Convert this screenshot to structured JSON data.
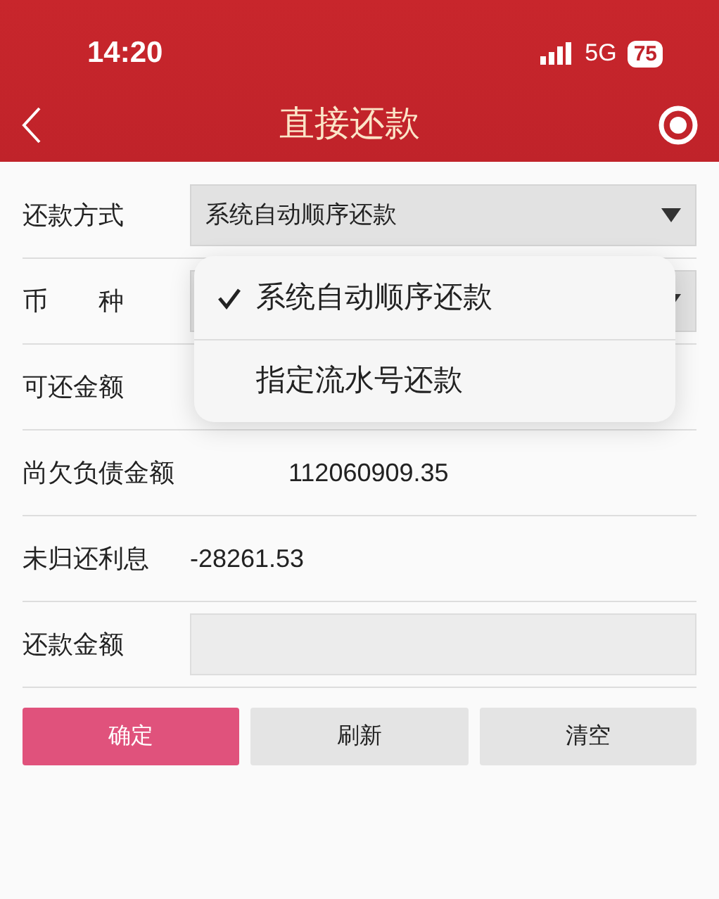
{
  "status_bar": {
    "time": "14:20",
    "network": "5G",
    "battery": "75"
  },
  "nav": {
    "title": "直接还款"
  },
  "form": {
    "rows": [
      {
        "kind": "select",
        "label": "还款方式",
        "value": "系统自动顺序还款"
      },
      {
        "kind": "select",
        "label": "币　　种"
      },
      {
        "kind": "text",
        "label": "可还金额"
      },
      {
        "kind": "text",
        "label": "尚欠负债金额",
        "value": "112060909.35"
      },
      {
        "kind": "text",
        "label": "未归还利息",
        "value": "-28261.53"
      },
      {
        "kind": "input",
        "label": "还款金额"
      }
    ]
  },
  "dropdown": {
    "options": [
      {
        "label": "系统自动顺序还款",
        "selected": true
      },
      {
        "label": "指定流水号还款",
        "selected": false
      }
    ]
  },
  "buttons": [
    {
      "label": "确定",
      "kind": "primary"
    },
    {
      "label": "刷新",
      "kind": "secondary"
    },
    {
      "label": "清空",
      "kind": "secondary"
    }
  ]
}
